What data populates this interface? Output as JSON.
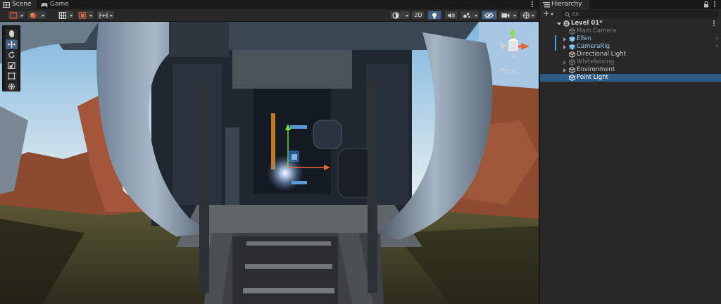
{
  "scene": {
    "tabs": [
      {
        "label": "Scene",
        "active": true
      },
      {
        "label": "Game",
        "active": false
      }
    ],
    "toolbar": {
      "left_buttons": [
        "shading-mode-icon",
        "gizmo-sphere-icon",
        "grid-icon",
        "snap-icon",
        "increment-icon"
      ],
      "right_toggle_2d": "2D",
      "right_buttons": [
        "draw-mode-icon",
        "lighting-icon",
        "audio-icon",
        "effects-icon",
        "visibility-icon",
        "camera-icon",
        "gizmos-icon"
      ]
    },
    "tools": [
      "view-hand-icon",
      "move-icon",
      "rotate-icon",
      "scale-icon",
      "rect-icon",
      "transform-icon"
    ],
    "active_tool": "move-icon",
    "gizmo_label": "Persp",
    "colors": {
      "x_axis": "#e8643c",
      "y_axis": "#7ce23c",
      "z_axis": "#3c8ce8",
      "selection": "#2c5d87",
      "toggle_on": "#46607e"
    }
  },
  "hierarchy": {
    "tab_label": "Hierarchy",
    "search_placeholder": "All",
    "add_label": "+",
    "items": [
      {
        "label": "Level 01*",
        "depth": 0,
        "expanded": true,
        "icon": "unity-scene-icon",
        "dim": false,
        "selected": false
      },
      {
        "label": "Main Camera",
        "depth": 1,
        "icon": "gameobject-icon",
        "dim": true,
        "selected": false
      },
      {
        "label": "Ellen",
        "depth": 1,
        "icon": "prefab-icon",
        "collapsed": true,
        "prefab": true,
        "dim": false,
        "selected": false
      },
      {
        "label": "CameraRig",
        "depth": 1,
        "icon": "prefab-icon",
        "collapsed": true,
        "prefab": true,
        "dim": false,
        "selected": false
      },
      {
        "label": "Directional Light",
        "depth": 1,
        "icon": "gameobject-icon",
        "dim": false,
        "selected": false
      },
      {
        "label": "Whiteboxing",
        "depth": 1,
        "icon": "gameobject-icon",
        "collapsed": true,
        "dim": true,
        "selected": false
      },
      {
        "label": "Environment",
        "depth": 1,
        "icon": "gameobject-icon",
        "collapsed": true,
        "dim": false,
        "selected": false
      },
      {
        "label": "Point Light",
        "depth": 1,
        "icon": "gameobject-icon",
        "dim": false,
        "selected": true
      }
    ]
  }
}
